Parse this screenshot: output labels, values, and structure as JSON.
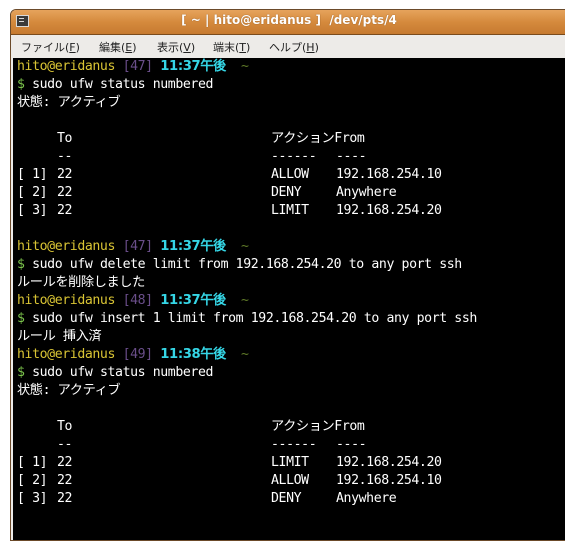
{
  "window": {
    "title": "[ ~ | hito@eridanus ]  /dev/pts/4",
    "icon": "terminal-icon"
  },
  "menubar": {
    "items": [
      {
        "label": "ファイル(F)",
        "base": "ファイル(",
        "key": "F",
        "tail": ")"
      },
      {
        "label": "編集(E)",
        "base": "編集(",
        "key": "E",
        "tail": ")"
      },
      {
        "label": "表示(V)",
        "base": "表示(",
        "key": "V",
        "tail": ")"
      },
      {
        "label": "端末(T)",
        "base": "端末(",
        "key": "T",
        "tail": ")"
      },
      {
        "label": "ヘルプ(H)",
        "base": "ヘルプ(",
        "key": "H",
        "tail": ")"
      }
    ]
  },
  "terminal": {
    "colors": {
      "background": "#000000",
      "foreground": "#ffffff",
      "user": "#d9c434",
      "history": "#6a4e8a",
      "time": "#35d6e6",
      "tilde": "#5f7a28",
      "dollar": "#7cc44c"
    },
    "blocks": [
      {
        "prompt": {
          "user": "hito@eridanus",
          "history": "[47]",
          "time": "11:37午後",
          "cwd": "~"
        },
        "command": "sudo ufw status numbered",
        "output": [
          "状態: アクティブ"
        ],
        "table": {
          "header": {
            "to": "To",
            "action_from": "アクションFrom"
          },
          "separator": {
            "to": "--",
            "action": "------",
            "from": "----"
          },
          "rows": [
            {
              "num": "[ 1]",
              "to": "22",
              "action": "ALLOW",
              "from": "192.168.254.10"
            },
            {
              "num": "[ 2]",
              "to": "22",
              "action": "DENY",
              "from": "Anywhere"
            },
            {
              "num": "[ 3]",
              "to": "22",
              "action": "LIMIT",
              "from": "192.168.254.20"
            }
          ]
        }
      },
      {
        "prompt": {
          "user": "hito@eridanus",
          "history": "[47]",
          "time": "11:37午後",
          "cwd": "~"
        },
        "command": "sudo ufw delete limit from 192.168.254.20 to any port ssh",
        "output": [
          "ルールを削除しました"
        ]
      },
      {
        "prompt": {
          "user": "hito@eridanus",
          "history": "[48]",
          "time": "11:37午後",
          "cwd": "~"
        },
        "command": "sudo ufw insert 1 limit from 192.168.254.20 to any port ssh",
        "output": [
          "ルール 挿入済"
        ]
      },
      {
        "prompt": {
          "user": "hito@eridanus",
          "history": "[49]",
          "time": "11:38午後",
          "cwd": "~"
        },
        "command": "sudo ufw status numbered",
        "output": [
          "状態: アクティブ"
        ],
        "table": {
          "header": {
            "to": "To",
            "action_from": "アクションFrom"
          },
          "separator": {
            "to": "--",
            "action": "------",
            "from": "----"
          },
          "rows": [
            {
              "num": "[ 1]",
              "to": "22",
              "action": "LIMIT",
              "from": "192.168.254.20"
            },
            {
              "num": "[ 2]",
              "to": "22",
              "action": "ALLOW",
              "from": "192.168.254.10"
            },
            {
              "num": "[ 3]",
              "to": "22",
              "action": "DENY",
              "from": "Anywhere"
            }
          ]
        }
      }
    ],
    "dollar": "$"
  }
}
